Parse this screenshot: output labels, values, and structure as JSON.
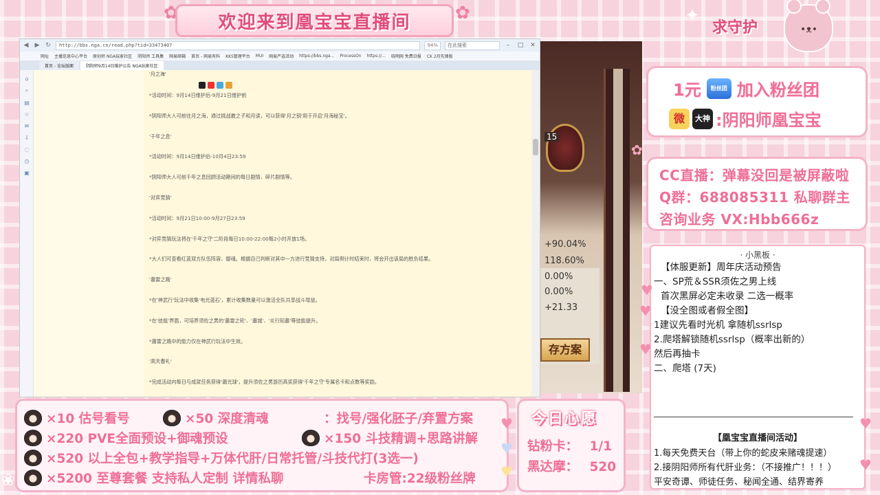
{
  "banner": {
    "title": "欢迎来到凰宝宝直播间"
  },
  "browser": {
    "url": "http://bbs.nga.cn/read.php?tid=33473407",
    "zoom": "94%",
    "search_placeholder": "在此搜索",
    "bookmarks": [
      "网址",
      "主播信息中心平台",
      "原创师 NGA玩家社区",
      "阴阳师 工具集",
      "网易邮箱",
      "首页 - 网易有料",
      "KKS管理平台",
      "MUI",
      "网易严选活动",
      "https://bbs.nga...",
      "ProcessOn",
      "https://...",
      "晓明网 免费日报",
      "CK 2月先锋版"
    ],
    "tabs": [
      {
        "label": "首页 - 论坛版面",
        "active": false
      },
      {
        "label": "阴阳师9月14日维护公告 NGA玩家社区",
        "active": true
      }
    ],
    "post_title": "'月之海'",
    "post_lines": [
      "*活动时间：9月14日维护后-9月21日维护前",
      "*阴阳师大人可前往月之海，通过挑战最之子和月读，可以获得'月之钥'用于开启'月海秘宝'。",
      "'千年之息'",
      "*活动时间：9月14日维护后-10月4日23:59",
      "*阴阳师大人可前千年之息回顾活动期间的每日剧情、碎片剧情等。",
      "'对弈竞猜'",
      "*活动时间：9月21日10:00-9月27日23:59",
      "*对弈竞猜玩法将在'千年之守'二阶段每日10:00-22:00每2小时开放1场。",
      "*大人们可查看红蓝双方队伍阵容、御魂。根据自己判断对其中一方进行竞猜支持，对局倒计时结束时，将会开出该局的胜负结果。",
      "'蕭雷之路'",
      "*在'神武行'玩法中收集'电光蓝石'，累计收集数量可以激活全队共享战斗增益。",
      "*在'技能'界面，可培养须佐之男的'蕭雷之轮'、'蕭城'、'炎行知蕭'等技能提升。",
      "*蕭雷之路中的能力仅在神武行玩法中生效。",
      "'高天春礼'",
      "*完成活动内每日与成就任务获得'蕭光球'，提升须佐之男游历高奖获得'千年之守'专属名卡和点数等奖励。"
    ]
  },
  "game": {
    "level": "15",
    "percents": [
      "+90.04%",
      "118.60%",
      "0.00%",
      "0.00%",
      "+21.33"
    ],
    "save_button": "存方案"
  },
  "right": {
    "title": "求守护",
    "fan_amount": "1元",
    "fan_badge": "粉丝团",
    "fan_join": "加入粉丝团",
    "weibo_glyph": "微",
    "dashen_label": "大神",
    "account": ":阴阳师凰宝宝",
    "contact_lines": [
      "CC直播：弹幕没回是被屏蔽啦",
      "Q群：688085311 私聊群主",
      "咨询业务 VX:Hbb666z"
    ]
  },
  "board": {
    "title": "· 小黑板 ·",
    "lines": [
      "【体服更新】周年庆活动预告",
      "一、SP荒＆SSR须佐之男上线",
      "首次黑屏必定未收录 二选一概率",
      "【没全图或者假全图】",
      "1建议先看时光机 拿随机ssrlsp",
      "2.爬塔解锁随机ssrlsp（概率出新的）",
      "然后再抽卡",
      "二、爬塔 (7天)"
    ],
    "separator": "——————————————————————",
    "activity_title": "【凰宝宝直播间活动】",
    "activities": [
      "1.每天免费天台（带上你的蛇皮来赌魂提速）",
      "2.接阴阳师所有代肝业务：（不接推广！！！）",
      "平安奇谭、师徒任务、秘闻全通、结界寄养"
    ]
  },
  "services": [
    "×10 估号看号",
    "×50 深度清魂",
    "：找号/强化胚子/弃置方案",
    "×220 PVE全面预设+御魂预设",
    "×150 斗技精调+思路讲解",
    "×520 以上全包+教学指导+万体代肝/日常托管/斗技代打(3选一)",
    "×5200 至尊套餐 支持私人定制 详情私聊",
    "卡房管:22级粉丝牌"
  ],
  "wish": {
    "title": "今日心愿",
    "items": [
      {
        "label": "钻粉卡：",
        "value": "1/1"
      },
      {
        "label": "黑达摩：",
        "value": "520"
      }
    ]
  }
}
